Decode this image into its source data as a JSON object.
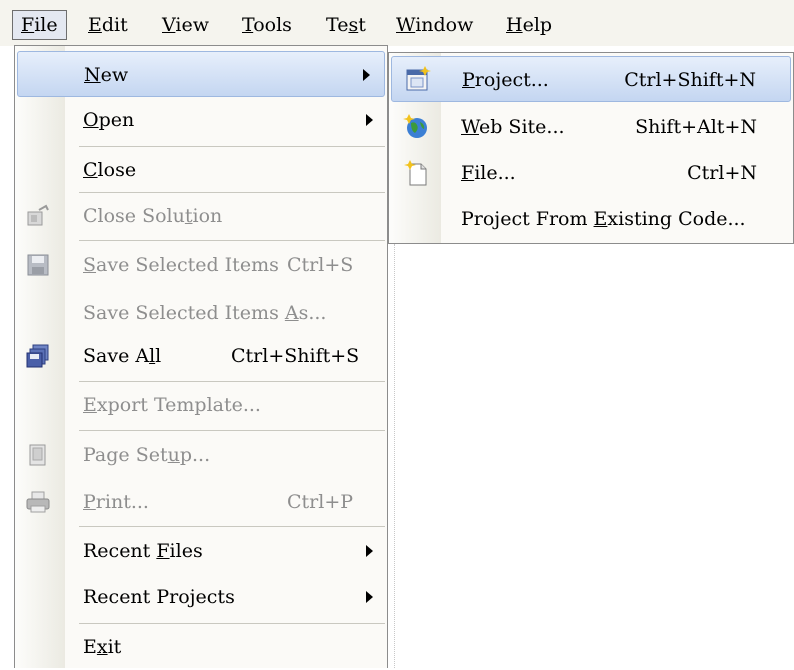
{
  "menubar": {
    "items": [
      {
        "label": "File",
        "mnemonic": "F",
        "rest": "ile"
      },
      {
        "label": "Edit",
        "mnemonic": "E",
        "rest": "dit"
      },
      {
        "label": "View",
        "mnemonic": "V",
        "rest": "iew"
      },
      {
        "label": "Tools",
        "mnemonic": "T",
        "rest": "ools"
      },
      {
        "label": "Test",
        "pre": "Te",
        "mnemonic": "s",
        "rest": "t"
      },
      {
        "label": "Window",
        "mnemonic": "W",
        "rest": "indow"
      },
      {
        "label": "Help",
        "mnemonic": "H",
        "rest": "elp"
      }
    ]
  },
  "file_menu": {
    "new": {
      "mnemonic": "N",
      "rest": "ew"
    },
    "open": {
      "mnemonic": "O",
      "rest": "pen"
    },
    "close": {
      "mnemonic": "C",
      "rest": "lose"
    },
    "close_solution": {
      "pre": "Close Solu",
      "mnemonic": "t",
      "rest": "ion"
    },
    "save_selected": {
      "mnemonic": "S",
      "rest": "ave Selected Items",
      "shortcut": "Ctrl+S"
    },
    "save_selected_as": {
      "pre": "Save Selected Items ",
      "mnemonic": "A",
      "rest": "s..."
    },
    "save_all": {
      "pre": "Save A",
      "mnemonic": "l",
      "rest": "l",
      "shortcut": "Ctrl+Shift+S"
    },
    "export_template": {
      "mnemonic": "E",
      "rest": "xport Template..."
    },
    "page_setup": {
      "pre": "Page Set",
      "mnemonic": "u",
      "rest": "p..."
    },
    "print": {
      "mnemonic": "P",
      "rest": "rint...",
      "shortcut": "Ctrl+P"
    },
    "recent_files": {
      "pre": "Recent ",
      "mnemonic": "F",
      "rest": "iles"
    },
    "recent_projects": {
      "label": "Recent Projects"
    },
    "exit": {
      "pre": "E",
      "mnemonic": "x",
      "rest": "it"
    }
  },
  "new_submenu": {
    "project": {
      "mnemonic": "P",
      "rest": "roject...",
      "shortcut": "Ctrl+Shift+N"
    },
    "web_site": {
      "mnemonic": "W",
      "rest": "eb Site...",
      "shortcut": "Shift+Alt+N"
    },
    "file": {
      "mnemonic": "F",
      "rest": "ile...",
      "shortcut": "Ctrl+N"
    },
    "existing": {
      "pre": "Project From ",
      "mnemonic": "E",
      "rest": "xisting Code..."
    }
  },
  "colors": {
    "highlight": "#c4d6f1",
    "disabled": "#8e8e8e",
    "menubar": "#f5f4ee"
  },
  "icons": [
    "close-solution-icon",
    "save-icon",
    "save-all-icon",
    "page-setup-icon",
    "print-icon",
    "new-project-icon",
    "web-site-icon",
    "new-file-icon"
  ]
}
